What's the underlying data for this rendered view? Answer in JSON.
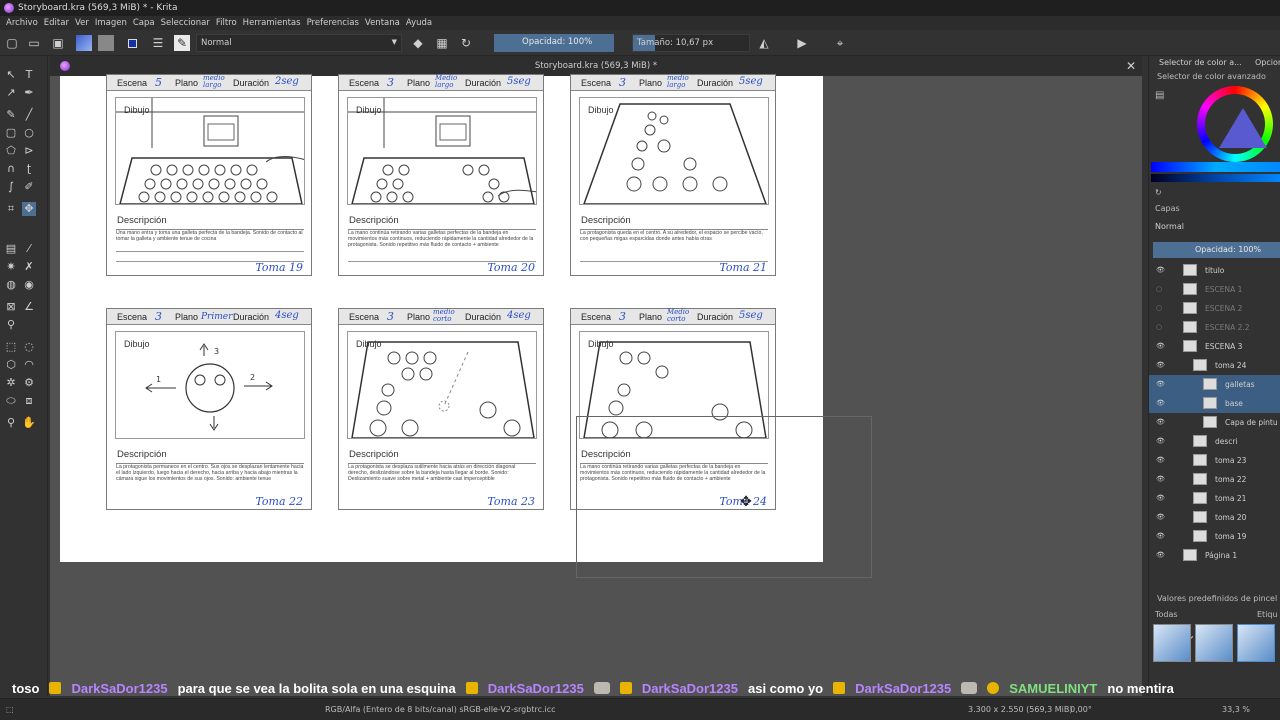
{
  "window": {
    "title": "Storyboard.kra (569,3 MiB) * - Krita"
  },
  "menu": [
    "Archivo",
    "Editar",
    "Ver",
    "Imagen",
    "Capa",
    "Seleccionar",
    "Filtro",
    "Herramientas",
    "Preferencias",
    "Ventana",
    "Ayuda"
  ],
  "toolbar": {
    "blend_mode": "Normal",
    "opacity": "Opacidad: 100%",
    "size": "Tamaño: 10,67 px"
  },
  "document_tab": {
    "title": "Storyboard.kra (569,3 MiB) *"
  },
  "panels": [
    {
      "escena": "5",
      "plano": "medio largo",
      "duracion": "2seg",
      "desc_title": "Descripción",
      "desc": "Una mano entra y toma una galleta perfecta de la bandeja. Sonido de contacto al tomar la galleta y ambiente tenue de cocina",
      "toma": "Toma 19",
      "dibujo": "Dibujo"
    },
    {
      "escena": "3",
      "plano": "Medio largo",
      "duracion": "5seg",
      "desc_title": "Descripción",
      "desc": "La mano continúa retirando varias galletas perfectas de la bandeja en movimientos más continuos, reduciendo rápidamente la cantidad alrededor de la protagonista. Sonido repetitivo más fluido de contacto + ambiente",
      "toma": "Toma 20",
      "dibujo": "Dibujo"
    },
    {
      "escena": "3",
      "plano": "medio largo",
      "duracion": "5seg",
      "desc_title": "Descripción",
      "desc": "La protagonista queda en el centro. A su alrededor, el espacio se percibe vacío, con pequeñas migas esparcidas donde antes había otras",
      "toma": "Toma 21",
      "dibujo": "Dibujo"
    },
    {
      "escena": "3",
      "plano": "Primer",
      "duracion": "4seg",
      "desc_title": "Descripción",
      "desc": "La protagonista permanece en el centro. Sus ojos se desplazan lentamente hacia el lado izquierdo, luego hacia el derecho, hacia arriba y hacia abajo mientras la cámara sigue los movimientos de sus ojos. Sonido: ambiente tenue",
      "toma": "Toma 22",
      "dibujo": "Dibujo"
    },
    {
      "escena": "3",
      "plano": "medio corto",
      "duracion": "4seg",
      "desc_title": "Descripción",
      "desc": "La protagonista se desplaza sutilmente hacia atrás en dirección diagonal derecho, deslizándose sobre la bandeja hasta llegar al borde. Sonido: Deslizamiento suave sobre metal + ambiente casi imperceptible",
      "toma": "Toma 23",
      "dibujo": "Dibujo"
    },
    {
      "escena": "3",
      "plano": "Medio corto",
      "duracion": "5seg",
      "desc_title": "Descripción",
      "desc": "La mano continúa retirando varias galletas perfectas de la bandeja en movimientos más continuos, reduciendo rápidamente la cantidad alrededor de la protagonista. Sonido repetitivo más fluido de contacto + ambiente",
      "toma": "Toma 24",
      "dibujo": "Dibujo"
    }
  ],
  "labels": {
    "escena": "Escena",
    "plano": "Plano",
    "duracion": "Duración"
  },
  "dock": {
    "tab1": "Selector de color a...",
    "tab2": "Opcione",
    "color_section": "Selector de color avanzado",
    "layers_section": "Capas",
    "blend": "Normal",
    "opacity": "Opacidad: 100%",
    "layers": [
      {
        "name": "titulo",
        "dim": false,
        "sel": false
      },
      {
        "name": "ESCENA 1",
        "dim": true,
        "sel": false
      },
      {
        "name": "ESCENA 2",
        "dim": true,
        "sel": false
      },
      {
        "name": "ESCENA 2.2",
        "dim": true,
        "sel": false
      },
      {
        "name": "ESCENA 3",
        "dim": false,
        "sel": false
      },
      {
        "name": "toma 24",
        "dim": false,
        "sel": false
      },
      {
        "name": "galletas",
        "dim": false,
        "sel": true
      },
      {
        "name": "base",
        "dim": false,
        "sel": true
      },
      {
        "name": "Capa de pintu",
        "dim": false,
        "sel": false
      },
      {
        "name": "descri",
        "dim": false,
        "sel": false
      },
      {
        "name": "toma 23",
        "dim": false,
        "sel": false
      },
      {
        "name": "toma 22",
        "dim": false,
        "sel": false
      },
      {
        "name": "toma 21",
        "dim": false,
        "sel": false
      },
      {
        "name": "toma 20",
        "dim": false,
        "sel": false
      },
      {
        "name": "toma 19",
        "dim": false,
        "sel": false
      },
      {
        "name": "Página 1",
        "dim": false,
        "sel": false
      }
    ],
    "brush_section": "Valores predefinidos de pincel",
    "brush_filter": "Todas",
    "brush_tag": "Etiqu"
  },
  "chat": {
    "m0": "toso",
    "u1": "DarkSaDor1235",
    "m1": "para que se vea la bolita sola en una esquina",
    "u2": "DarkSaDor1235",
    "u3": "DarkSaDor1235",
    "m3": "asi como yo",
    "u4": "DarkSaDor1235",
    "u5": "SAMUELINIYT",
    "m5": "no mentira"
  },
  "status": {
    "color": "RGB/Alfa (Entero de 8 bits/canal)  sRGB-elle-V2-srgbtrc.icc",
    "dims": "3.300 x 2.550 (569,3 MiB)",
    "angle": "0,00°",
    "zoom": "33,3 %"
  }
}
